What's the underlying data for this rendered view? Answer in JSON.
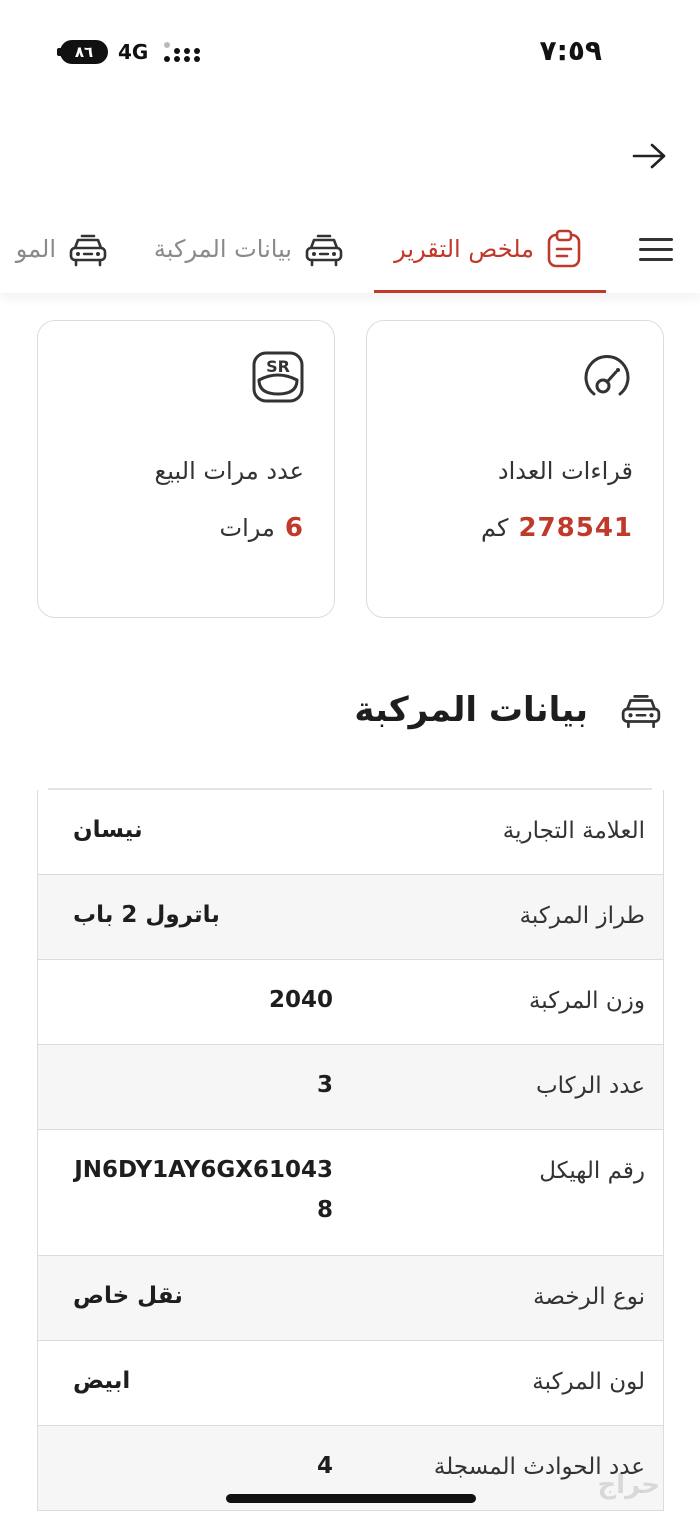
{
  "status_bar": {
    "time": "٧:٥٩",
    "battery": "٨٦",
    "network": "4G"
  },
  "tabs": {
    "summary": "ملخص التقرير",
    "vehicle_data": "بيانات المركبة",
    "next_partial": "المو"
  },
  "cards": {
    "odometer": {
      "title": "قراءات العداد",
      "value": "278541",
      "unit": "كم"
    },
    "sales": {
      "title": "عدد مرات البيع",
      "value": "6",
      "unit": "مرات",
      "badge": "SR"
    }
  },
  "section": {
    "title": "بيانات المركبة"
  },
  "rows": [
    {
      "label": "العلامة التجارية",
      "value": "نيسان"
    },
    {
      "label": "طراز المركبة",
      "value": "باترول 2 باب"
    },
    {
      "label": "وزن المركبة",
      "value": "2040"
    },
    {
      "label": "عدد الركاب",
      "value": "3"
    },
    {
      "label": "رقم الهيكل",
      "value": "JN6DY1AY6GX610438"
    },
    {
      "label": "نوع الرخصة",
      "value": "نقل خاص"
    },
    {
      "label": "لون المركبة",
      "value": "ابيض"
    },
    {
      "label": "عدد الحوادث المسجلة",
      "value": "4"
    }
  ],
  "watermark": "حراج",
  "colors": {
    "accent": "#c0392b",
    "border": "#dcdcdc",
    "shaded_row": "#f6f6f6"
  },
  "icons": [
    "back-arrow-icon",
    "menu-icon",
    "clipboard-icon",
    "car-icon",
    "gauge-icon",
    "sr-badge-icon"
  ]
}
